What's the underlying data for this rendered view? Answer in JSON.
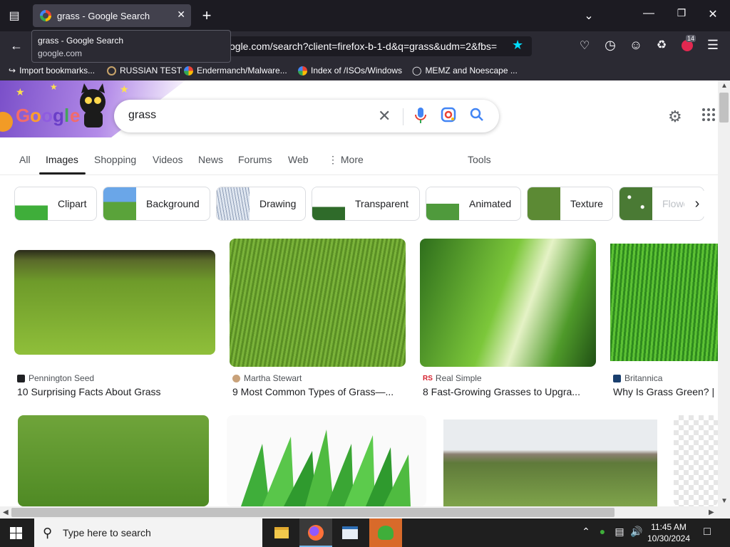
{
  "browser": {
    "tab": {
      "title": "grass - Google Search"
    },
    "new_tab": "+",
    "tooltip": {
      "title": "grass - Google Search",
      "subtitle": "google.com"
    },
    "url": "ogle.com/search?client=firefox-b-1-d&q=grass&udm=2&fbs=",
    "bookmarks": [
      {
        "label": "Import bookmarks...",
        "icon": "import-icon",
        "color": "#fbfbfe"
      },
      {
        "label": "RUSSIAN TEST",
        "icon": "search-icon",
        "color": "#c7a36a"
      },
      {
        "label": "Endermanch/Malware...",
        "icon": "google-icon",
        "color": "#ffffff"
      },
      {
        "label": "Index of /ISOs/Windows",
        "icon": "google-icon",
        "color": "#ffffff"
      },
      {
        "label": "MEMZ and Noescape ...",
        "icon": "globe-icon",
        "color": "#fbfbfe"
      }
    ],
    "extension_badge": "14"
  },
  "google": {
    "query": "grass",
    "tabs": [
      {
        "label": "All",
        "active": false
      },
      {
        "label": "Images",
        "active": true
      },
      {
        "label": "Shopping",
        "active": false
      },
      {
        "label": "Videos",
        "active": false
      },
      {
        "label": "News",
        "active": false
      },
      {
        "label": "Forums",
        "active": false
      },
      {
        "label": "Web",
        "active": false
      },
      {
        "label": "⋮ More",
        "active": false
      }
    ],
    "tools_label": "Tools",
    "chips": [
      "Clipart",
      "Background",
      "Drawing",
      "Transparent",
      "Animated",
      "Texture",
      "Flowers"
    ],
    "results_row1": [
      {
        "source": "Pennington Seed",
        "title": "10 Surprising Facts About Grass"
      },
      {
        "source": "Martha Stewart",
        "title": "9 Most Common Types of Grass—..."
      },
      {
        "source": "Real Simple",
        "title": "8 Fast-Growing Grasses to Upgra..."
      },
      {
        "source": "Britannica",
        "title": "Why Is Grass Green? |"
      }
    ]
  },
  "taskbar": {
    "search_placeholder": "Type here to search",
    "time": "11:45 AM",
    "date": "10/30/2024"
  },
  "colors": {
    "google_blue": "#4285f4",
    "google_red": "#ea4335",
    "google_yellow": "#fbbc05",
    "google_green": "#34a853"
  }
}
